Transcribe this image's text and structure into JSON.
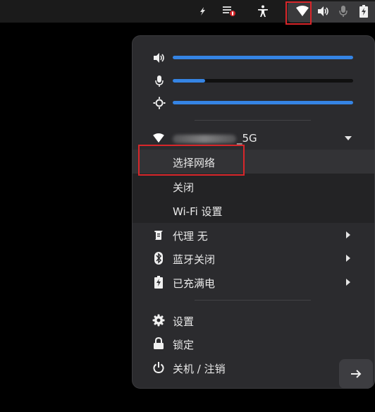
{
  "topbar": {
    "icons": [
      "flash-icon",
      "keyboard-badge-icon",
      "accessibility-icon",
      "wifi-icon",
      "volume-icon",
      "microphone-icon",
      "battery-charging-icon"
    ],
    "badge_color": "#d8262a"
  },
  "sliders": [
    {
      "name": "volume",
      "icon": "volume-icon",
      "level": 1.0
    },
    {
      "name": "microphone",
      "icon": "microphone-icon",
      "level": 0.18
    },
    {
      "name": "brightness",
      "icon": "brightness-icon",
      "level": 1.0
    }
  ],
  "wifi": {
    "ssid_suffix": "_5G",
    "submenu": [
      "选择网络",
      "关闭",
      "Wi-Fi 设置"
    ]
  },
  "menu": {
    "proxy": "代理 无",
    "bluetooth": "蓝牙关闭",
    "battery": "已充满电",
    "settings": "设置",
    "lock": "锁定",
    "power": "关机 / 注销"
  },
  "colors": {
    "accent": "#3584e4",
    "panel_bg": "#2b2b2e",
    "highlight": "#d8262a"
  }
}
